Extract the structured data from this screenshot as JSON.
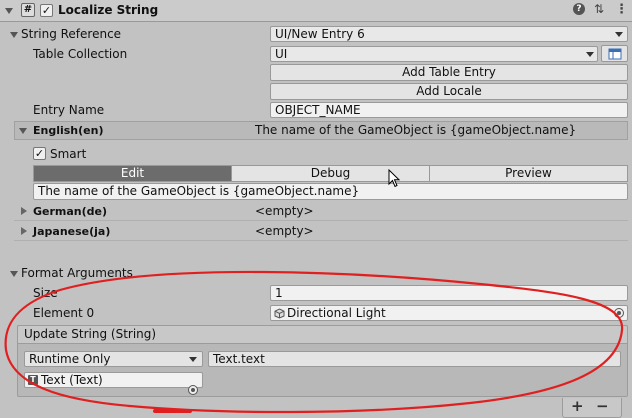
{
  "component": {
    "title": "Localize String",
    "enabled": true
  },
  "string_reference": {
    "label": "String Reference",
    "value": "UI/New Entry 6",
    "table_collection_label": "Table Collection",
    "table_collection_value": "UI",
    "add_table_entry": "Add Table Entry",
    "add_locale": "Add Locale",
    "entry_name_label": "Entry Name",
    "entry_name_value": "OBJECT_NAME"
  },
  "locales": {
    "english": {
      "label": "English(en)",
      "preview": "The name of the GameObject is {gameObject.name}",
      "smart_label": "Smart",
      "smart_checked": true,
      "tabs": [
        "Edit",
        "Debug",
        "Preview"
      ],
      "active_tab": "Edit",
      "text_value": "The name of the GameObject is {gameObject.name}"
    },
    "german": {
      "label": "German(de)",
      "value": "<empty>"
    },
    "japanese": {
      "label": "Japanese(ja)",
      "value": "<empty>"
    }
  },
  "format_arguments": {
    "label": "Format Arguments",
    "size_label": "Size",
    "size_value": "1",
    "element0_label": "Element 0",
    "element0_value": "Directional Light"
  },
  "update_string": {
    "title": "Update String (String)",
    "runtime_option": "Runtime Only",
    "function_value": "Text.text",
    "object_value": "Text (Text)",
    "add_symbol": "+",
    "remove_symbol": "−"
  },
  "icons": {
    "hash": "#",
    "help": "?",
    "preset": "⇅",
    "menu": "⋮"
  },
  "colors": {
    "annotation": "#e02020",
    "active_tab": "#6c6c6c"
  }
}
